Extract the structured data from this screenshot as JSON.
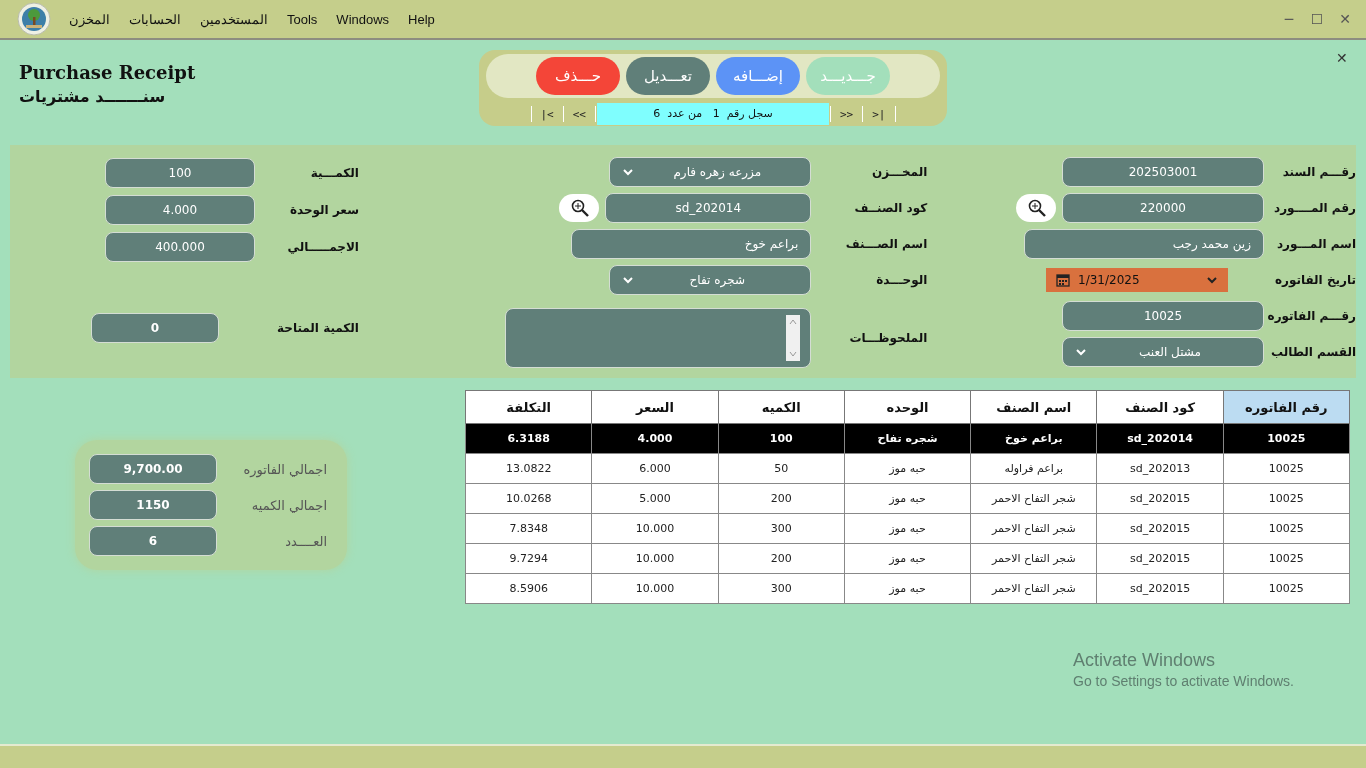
{
  "menu": [
    {
      "label": "Help"
    },
    {
      "label": "Windows"
    },
    {
      "label": "Tools"
    },
    {
      "label": "المستخدمين"
    },
    {
      "label": "الحسابات"
    },
    {
      "label": "المخزن"
    }
  ],
  "window_controls": [
    "✕",
    "☐",
    "─"
  ],
  "form_close": "✕",
  "title": {
    "english": "Purchase Receipt",
    "arabic": "سنـــــــد مشتريات"
  },
  "toolbar": {
    "buttons": [
      {
        "label": "جـــديـــد",
        "kind": "new"
      },
      {
        "label": "إضـــافه",
        "kind": "add"
      },
      {
        "label": "تعـــديل",
        "kind": "edit"
      },
      {
        "label": "حـــذف",
        "kind": "delete"
      }
    ],
    "navigator": {
      "first": "|<",
      "previous": "<<",
      "record_label": "سجل رقم",
      "current": "1",
      "of_label": "من عدد",
      "total": "6",
      "next": ">>",
      "last": ">|"
    }
  },
  "form": {
    "right": [
      {
        "label": "رقـــم السند",
        "value": "202503001",
        "kind": "text"
      },
      {
        "label": "رقم المــــورد",
        "value": "220000",
        "kind": "lookup"
      },
      {
        "label": "اسم المـــورد",
        "value": "زين محمد رجب",
        "kind": "wide"
      },
      {
        "label": "تاريخ الفاتوره",
        "value": "1/31/2025",
        "kind": "date"
      },
      {
        "label": "رقـــم الفاتوره",
        "value": "10025",
        "kind": "text"
      },
      {
        "label": "القسم الطالب",
        "value": "مشتل العنب",
        "kind": "select"
      }
    ],
    "middle": [
      {
        "label": "المخـــزن",
        "value": "مزرعه زهره فارم",
        "kind": "select"
      },
      {
        "label": "كود الصنــف",
        "value": "sd_202014",
        "kind": "lookup"
      },
      {
        "label": "اسم الصـــنف",
        "value": "براعم خوخ",
        "kind": "wide"
      },
      {
        "label": "الوحـــدة",
        "value": "شجره تفاح",
        "kind": "select"
      },
      {
        "label": "الملحوظـــات",
        "kind": "notes"
      }
    ],
    "left": [
      {
        "label": "الكمـــية",
        "value": "100",
        "kind": "text"
      },
      {
        "label": "سعر الوحدة",
        "value": "4.000",
        "kind": "text"
      },
      {
        "label": "الاجمـــــالي",
        "value": "400.000",
        "kind": "text"
      },
      {
        "label": "الكمية المتاحة",
        "value": "0",
        "kind": "available"
      }
    ]
  },
  "table": {
    "columns": [
      {
        "label": "رقم الفاتوره",
        "highlighted": true
      },
      {
        "label": "كود الصنف",
        "highlighted": false
      },
      {
        "label": "اسم الصنف",
        "highlighted": false
      },
      {
        "label": "الوحده",
        "highlighted": false
      },
      {
        "label": "الكميه",
        "highlighted": false
      },
      {
        "label": "السعر",
        "highlighted": false
      },
      {
        "label": "التكلفة",
        "highlighted": false
      }
    ],
    "rows": [
      {
        "selected": true,
        "cells": [
          "10025",
          "sd_202014",
          "براعم خوخ",
          "شجره تفاح",
          "100",
          "4.000",
          "6.3188"
        ]
      },
      {
        "selected": false,
        "cells": [
          "10025",
          "sd_202013",
          "براعم فراوله",
          "حبه موز",
          "50",
          "6.000",
          "13.0822"
        ]
      },
      {
        "selected": false,
        "cells": [
          "10025",
          "sd_202015",
          "شجر التفاح الاحمر",
          "حبه موز",
          "200",
          "5.000",
          "10.0268"
        ]
      },
      {
        "selected": false,
        "cells": [
          "10025",
          "sd_202015",
          "شجر التفاح الاحمر",
          "حبه موز",
          "300",
          "10.000",
          "7.8348"
        ]
      },
      {
        "selected": false,
        "cells": [
          "10025",
          "sd_202015",
          "شجر التفاح الاحمر",
          "حبه موز",
          "200",
          "10.000",
          "9.7294"
        ]
      },
      {
        "selected": false,
        "cells": [
          "10025",
          "sd_202015",
          "شجر التفاح الاحمر",
          "حبه موز",
          "300",
          "10.000",
          "8.5906"
        ]
      }
    ]
  },
  "totals": [
    {
      "label": "اجمالي الفاتوره",
      "value": "9,700.00"
    },
    {
      "label": "اجمالي الكميه",
      "value": "1150"
    },
    {
      "label": "العــــدد",
      "value": "6"
    }
  ],
  "os_notice": {
    "title": "Activate Windows",
    "text": "Go to Settings to activate Windows."
  }
}
